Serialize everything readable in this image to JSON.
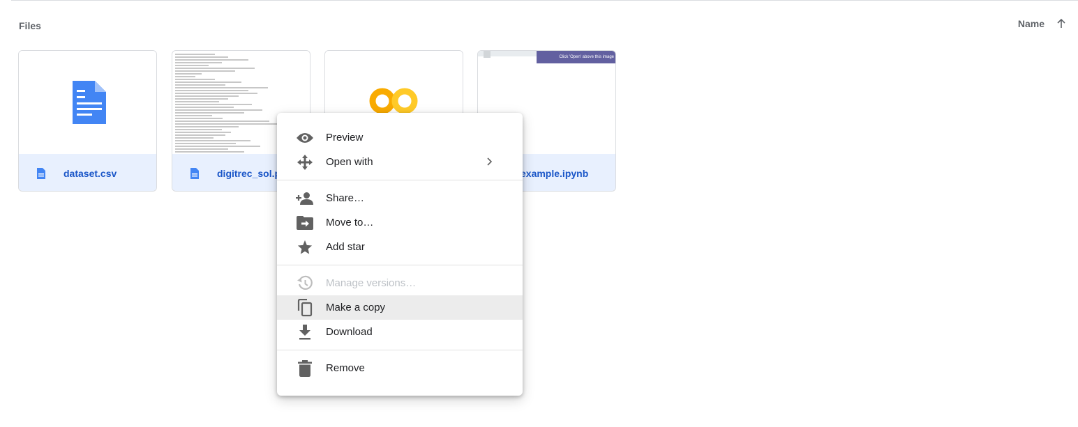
{
  "header": {
    "section_title": "Files",
    "sort_label": "Name",
    "sort_direction_icon": "arrow-up-icon"
  },
  "files": [
    {
      "name": "dataset.csv",
      "icon": "document-icon"
    },
    {
      "name": "digitrec_sol.py",
      "icon": "document-icon"
    },
    {
      "name": "",
      "icon": "colab-logo"
    },
    {
      "name": "example.ipynb",
      "icon": "document-icon",
      "thumbnail_banner": "Click 'Open' above this image"
    }
  ],
  "context_menu": {
    "groups": [
      [
        {
          "label": "Preview",
          "icon": "eye-icon"
        },
        {
          "label": "Open with",
          "icon": "move-arrows-icon",
          "submenu": true
        }
      ],
      [
        {
          "label": "Share…",
          "icon": "add-person-icon"
        },
        {
          "label": "Move to…",
          "icon": "folder-move-icon"
        },
        {
          "label": "Add star",
          "icon": "star-icon"
        }
      ],
      [
        {
          "label": "Manage versions…",
          "icon": "history-icon",
          "disabled": true
        },
        {
          "label": "Make a copy",
          "icon": "copy-icon",
          "highlighted": true
        },
        {
          "label": "Download",
          "icon": "download-icon"
        }
      ],
      [
        {
          "label": "Remove",
          "icon": "trash-icon"
        }
      ]
    ]
  },
  "colors": {
    "accent": "#1a56c8",
    "card_footer": "#e8f0fe",
    "doc_icon": "#4285f4",
    "colab_orange": "#f9ab00",
    "colab_yellow": "#ffca28"
  }
}
